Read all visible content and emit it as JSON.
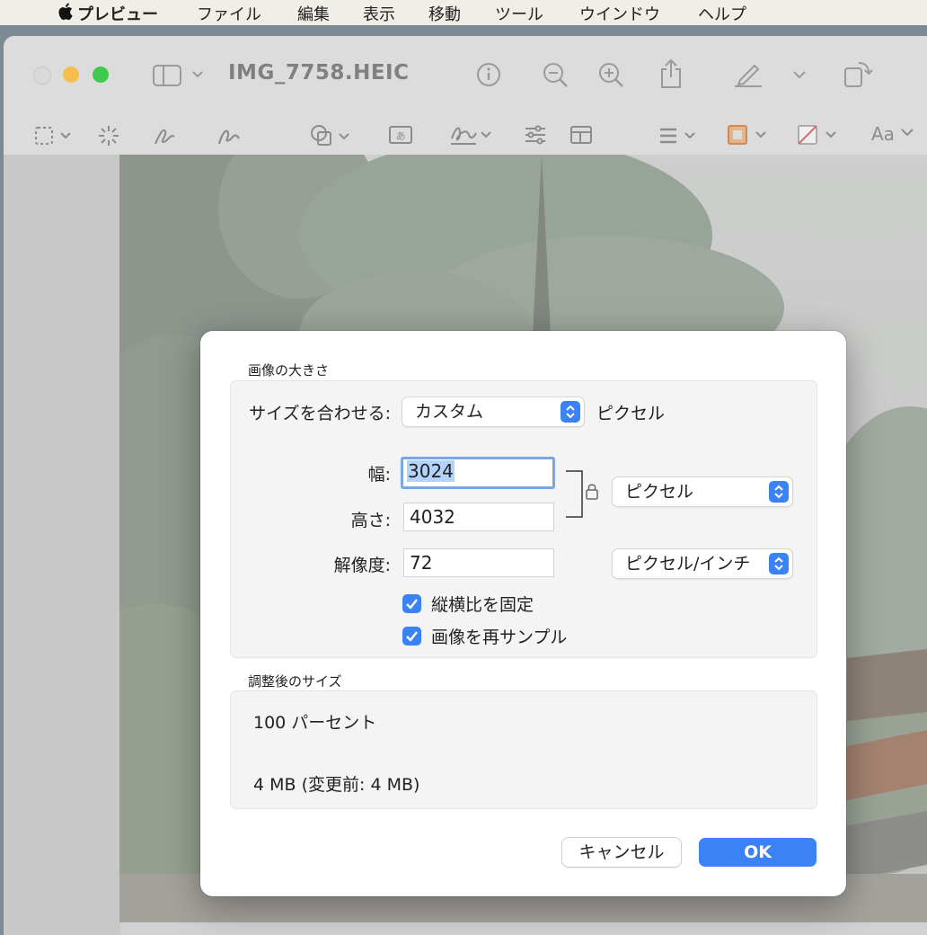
{
  "menubar": {
    "app": "プレビュー",
    "items": [
      "ファイル",
      "編集",
      "表示",
      "移動",
      "ツール",
      "ウインドウ",
      "ヘルプ"
    ]
  },
  "window": {
    "title": "IMG_7758.HEIC",
    "markup_text_label": "Aa"
  },
  "dialog": {
    "image_size_section": "画像の大きさ",
    "fit_into_label": "サイズを合わせる:",
    "fit_into_value": "カスタム",
    "fit_into_unit": "ピクセル",
    "width_label": "幅:",
    "width_value": "3024",
    "height_label": "高さ:",
    "height_value": "4032",
    "dimension_unit": "ピクセル",
    "resolution_label": "解像度:",
    "resolution_value": "72",
    "resolution_unit": "ピクセル/インチ",
    "scale_proportionally": "縦横比を固定",
    "resample_image": "画像を再サンプル",
    "resulting_size_section": "調整後のサイズ",
    "percent_text": "100 パーセント",
    "filesize_text": "4 MB (変更前: 4 MB)",
    "cancel_label": "キャンセル",
    "ok_label": "OK"
  },
  "colors": {
    "accent": "#3b82f6",
    "close": "#d9d9d9",
    "minimize": "#f6be4f",
    "zoom": "#3fc94e"
  }
}
